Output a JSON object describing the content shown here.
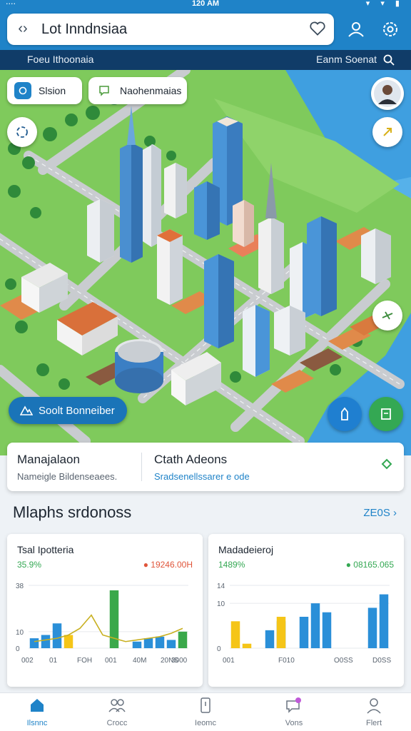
{
  "status": {
    "time": "120 AM",
    "left": "⋅⋅⋅⋅"
  },
  "search": {
    "query": "Lot Inndnsiaa"
  },
  "subbar": {
    "left": "Foeu Ithoonaia",
    "right": "Eanm Soenat"
  },
  "map": {
    "chip_left": "Slsion",
    "chip_right": "Naohenmaias",
    "pill_label": "Soolt Bonneiber"
  },
  "info": {
    "left_title": "Manajalaon",
    "left_sub": "Nameigle Bildenseaees.",
    "right_title": "Ctath Adeons",
    "right_sub": "Sradsenellssarer e ode"
  },
  "section": {
    "title": "Mlaphs srdonoss",
    "link": "ZE0S ›"
  },
  "cards": [
    {
      "title": "Tsal Ipotteria",
      "pct": "35.9%",
      "value": "● 19246.00H"
    },
    {
      "title": "Madadeieroj",
      "pct": "1489%",
      "value": "● 08165.065"
    }
  ],
  "chart_data": [
    {
      "type": "bar",
      "title": "Tsal Ipotteria",
      "yticks": [
        "0",
        "10",
        "38"
      ],
      "xticks": [
        "002",
        "01",
        "FOH",
        "001",
        "40M",
        "20NS",
        "3000"
      ],
      "ylim": [
        0,
        38
      ],
      "series": [
        {
          "color": "#2a8fd8",
          "values": [
            6,
            8,
            15,
            0,
            0,
            0,
            0,
            0,
            0,
            4,
            6,
            7,
            5,
            0
          ]
        },
        {
          "color": "#f5c518",
          "values": [
            0,
            0,
            0,
            8,
            0,
            0,
            0,
            0,
            0,
            0,
            0,
            0,
            0,
            0
          ]
        },
        {
          "color": "#3aa84a",
          "values": [
            0,
            0,
            0,
            0,
            0,
            0,
            0,
            35,
            0,
            0,
            0,
            0,
            0,
            10
          ]
        }
      ],
      "line": [
        4,
        5,
        6,
        8,
        12,
        20,
        8,
        6,
        4,
        5,
        6,
        7,
        9,
        12
      ]
    },
    {
      "type": "bar",
      "title": "Madadeieroj",
      "yticks": [
        "0",
        "10",
        "14"
      ],
      "xticks": [
        "001",
        "F010",
        "O0SS",
        "D0SS"
      ],
      "ylim": [
        0,
        14
      ],
      "series": [
        {
          "color": "#2a8fd8",
          "values": [
            0,
            0,
            0,
            4,
            6,
            0,
            7,
            10,
            8,
            0,
            0,
            0,
            9,
            12
          ]
        },
        {
          "color": "#f5c518",
          "values": [
            6,
            1,
            0,
            0,
            7,
            0,
            0,
            0,
            0,
            0,
            0,
            0,
            0,
            0
          ]
        }
      ]
    }
  ],
  "tabs": [
    {
      "label": "Ilsnnc",
      "icon": "home-icon",
      "active": true
    },
    {
      "label": "Crocc",
      "icon": "people-icon",
      "active": false
    },
    {
      "label": "Ieomc",
      "icon": "door-icon",
      "active": false
    },
    {
      "label": "Vons",
      "icon": "chat-icon",
      "active": false
    },
    {
      "label": "Flert",
      "icon": "user-icon",
      "active": false
    }
  ]
}
